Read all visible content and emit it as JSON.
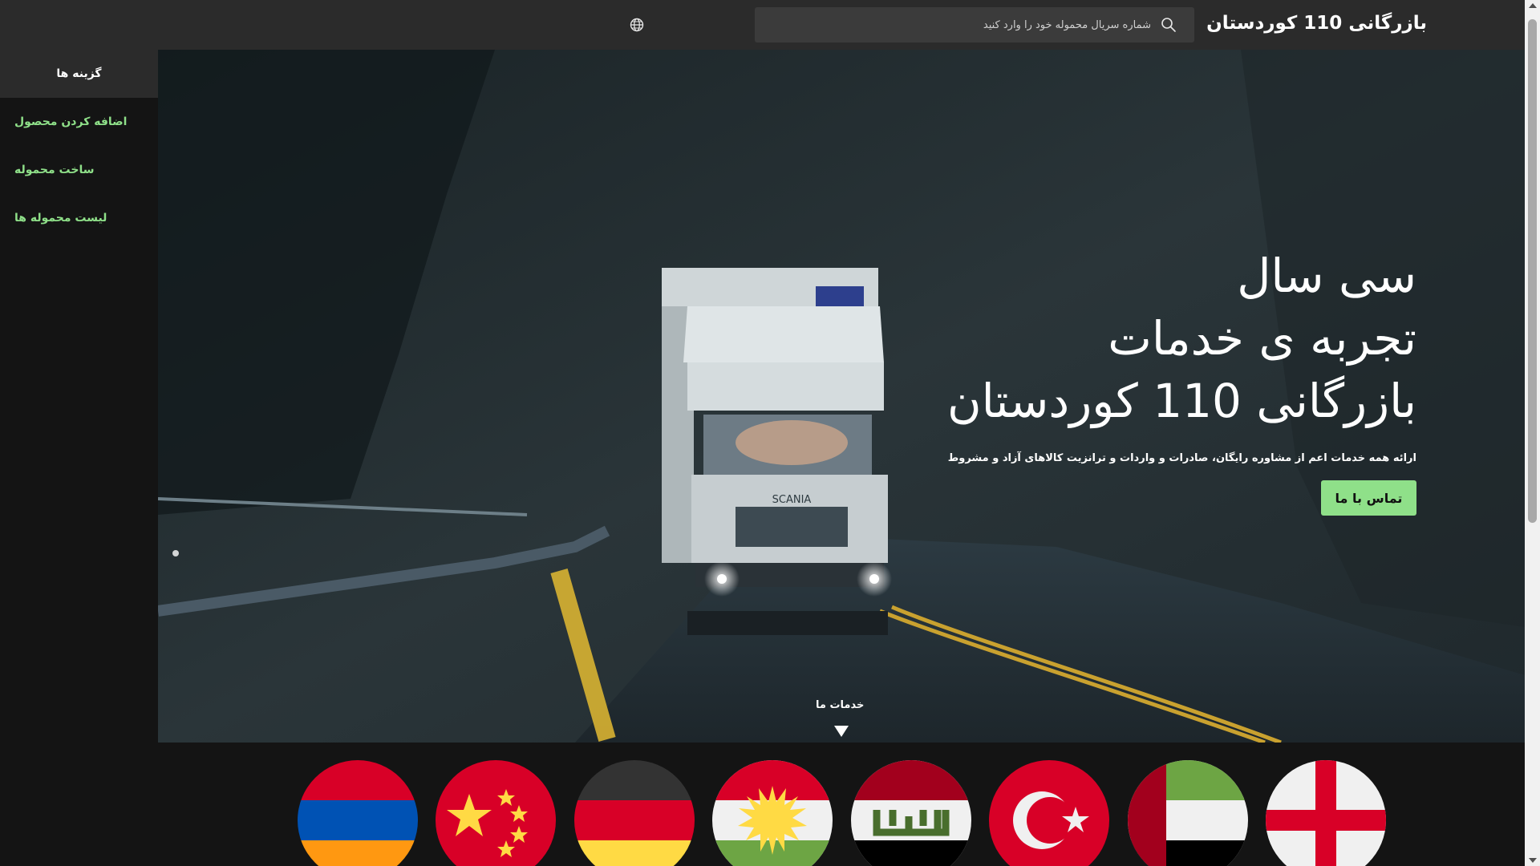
{
  "header": {
    "brand": "بازرگانی 110 کوردستان",
    "search_placeholder": "شماره سریال محموله خود را وارد کنید",
    "icons": {
      "search": "search-icon",
      "language": "globe-icon"
    }
  },
  "sidebar": {
    "title": "گزینه ها",
    "items": [
      {
        "label": "اضافه کردن محصول"
      },
      {
        "label": "ساخت محموله"
      },
      {
        "label": "لیست محموله ها"
      }
    ]
  },
  "hero": {
    "title_lines": [
      "سی سال",
      "تجربه ی خدمات",
      "بازرگانی 110 کوردستان"
    ],
    "subtitle": "ارائه همه خدمات اعم از مشاوره رایگان، صادرات و واردات و ترانزیت کالاهای آزاد و مشروط",
    "cta_label": "تماس با ما",
    "services_label": "خدمات ما"
  },
  "flags": [
    "england",
    "uae",
    "turkey",
    "iraq",
    "kurdistan",
    "germany",
    "china",
    "armenia"
  ],
  "colors": {
    "accent": "#8fe089",
    "topbar": "#2b2b2b",
    "background": "#141414"
  }
}
